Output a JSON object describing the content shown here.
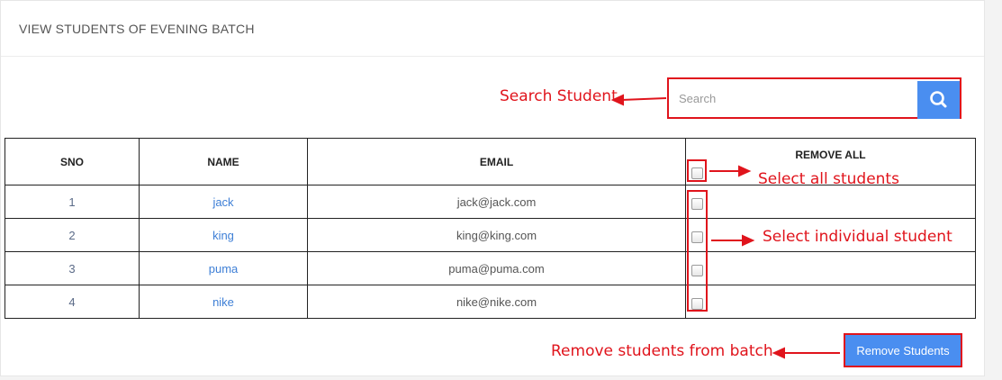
{
  "header": {
    "title": "VIEW STUDENTS OF EVENING BATCH"
  },
  "search": {
    "placeholder": "Search",
    "icon": "search-icon"
  },
  "table": {
    "columns": [
      "SNO",
      "NAME",
      "EMAIL",
      "REMOVE ALL"
    ],
    "rows": [
      {
        "sno": "1",
        "name": "jack",
        "email": "jack@jack.com",
        "selected": false
      },
      {
        "sno": "2",
        "name": "king",
        "email": "king@king.com",
        "selected": false
      },
      {
        "sno": "3",
        "name": "puma",
        "email": "puma@puma.com",
        "selected": false
      },
      {
        "sno": "4",
        "name": "nike",
        "email": "nike@nike.com",
        "selected": false
      }
    ]
  },
  "actions": {
    "remove_label": "Remove Students"
  },
  "annotations": {
    "search": "Search Student",
    "select_all": "Select all students",
    "select_individual": "Select individual student",
    "remove": "Remove students from batch"
  },
  "colors": {
    "accent": "#4a8ef0",
    "annotation": "#e0141c",
    "link": "#3e7fd6"
  }
}
